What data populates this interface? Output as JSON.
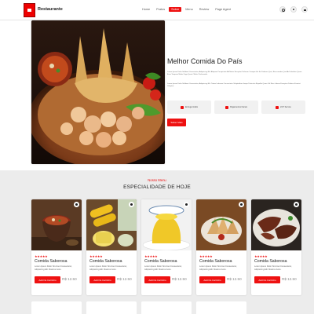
{
  "nav": {
    "brand": "Restaurante",
    "menu": [
      "Home",
      "Pratos",
      "Sobre",
      "Menu",
      "Review",
      "Page Agent"
    ],
    "active_index": 2,
    "icons": [
      "search-icon",
      "user-icon",
      "cart-icon"
    ]
  },
  "hero": {
    "title": "Melhor Comida Do País",
    "paragraph1": "Lorem Ipsum Dolor Sit Amet Consectetur, Adipisicing Elit. Aliquam Perspiciatis Ad Natus Excepturi Dolorum Cumque Hic Ex Dolorem Quis, Recusandae Quo Ab Doloribus Quam Error Tempora Nobis Fuga Quasi Officiis Perferendis.",
    "paragraph2": "Lorem Ipsum Dolor Sit Amet Consectetur, Adipisicing Elit. Totam Laborum Consectetur Voluptatibus Itaque Distinctio Repellat Quam Vel Rem Labore Excepturi Dolores Eveniet Voluptas.",
    "features": [
      {
        "icon": "truck-icon",
        "label": "Entrega Grátis"
      },
      {
        "icon": "card-icon",
        "label": "Pagamentos Fáceis"
      },
      {
        "icon": "headset-icon",
        "label": "24/7 Service"
      }
    ],
    "button": "Saber Mais"
  },
  "specials": {
    "subtitle": "Nosso Menu",
    "title": "ESPECIALIDADE DE HOJE",
    "cards": [
      {
        "name": "Comida Saborosa",
        "desc": "Lorem Ipsum Dolor Sit Amet Consectetur, Adipisicing Elit. Maxime Iusto.",
        "button": "Add No Carrinho",
        "price": "R$ 12.50",
        "rating": "★★★★★"
      },
      {
        "name": "Comida Saborosa",
        "desc": "Lorem Ipsum Dolor Sit Amet Consectetur, Adipisicing Elit. Maxime Iusto.",
        "button": "Add No Carrinho",
        "price": "R$ 12.50",
        "rating": "★★★★★"
      },
      {
        "name": "Comida Saborosa",
        "desc": "Lorem Ipsum Dolor Sit Amet Consectetur, Adipisicing Elit. Maxime Iusto.",
        "button": "Add No Carrinho",
        "price": "R$ 12.50",
        "rating": "★★★★★"
      },
      {
        "name": "Comida Saborosa",
        "desc": "Lorem Ipsum Dolor Sit Amet Consectetur, Adipisicing Elit. Maxime Iusto.",
        "button": "Add No Carrinho",
        "price": "R$ 12.50",
        "rating": "★★★★★"
      },
      {
        "name": "Comida Saborosa",
        "desc": "Lorem Ipsum Dolor Sit Amet Consectetur, Adipisicing Elit. Maxime Iusto.",
        "button": "Add No Carrinho",
        "price": "R$ 12.50",
        "rating": "★★★★★"
      }
    ]
  },
  "colors": {
    "accent": "#ee1111",
    "section_bg": "#ececec"
  }
}
